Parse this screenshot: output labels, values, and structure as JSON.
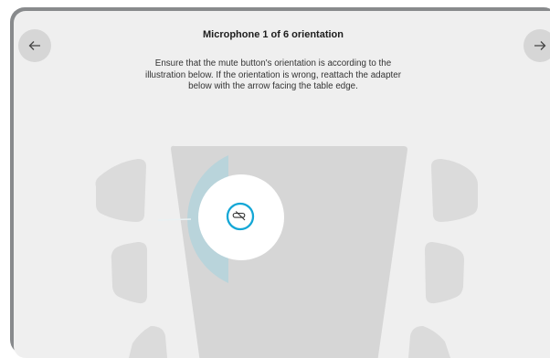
{
  "header": {
    "title": "Microphone 1 of 6 orientation",
    "description": "Ensure that the mute button's orientation is according to the illustration below. If the orientation is wrong, reattach the adapter below with the arrow facing the table edge."
  },
  "nav": {
    "prev_icon": "arrow-left-icon",
    "next_icon": "arrow-right-icon"
  },
  "illustration": {
    "seat_count": 6,
    "mute_icon": "mic-muted-icon",
    "colors": {
      "panel": "#efefef",
      "table": "#d6d6d6",
      "chair": "#dbdbdb",
      "arc": "#b9d4db",
      "mute_ring": "#14a7d6"
    }
  }
}
